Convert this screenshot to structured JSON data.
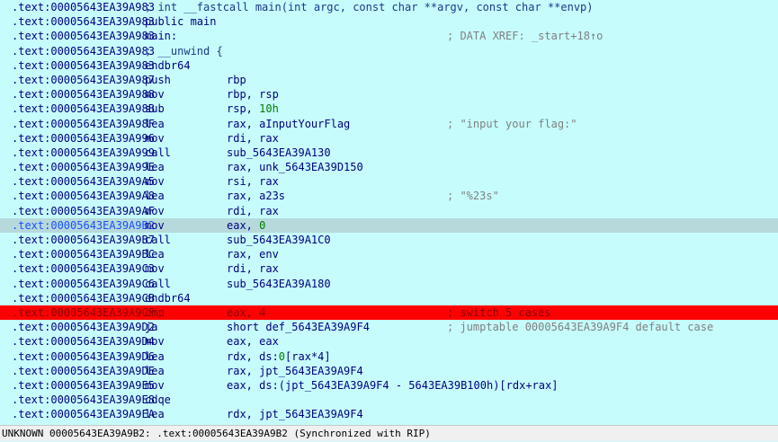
{
  "lines": [
    {
      "addr": ".text:00005643EA39A983",
      "full": "; int __fastcall main(int argc, const char **argv, const char **envp)"
    },
    {
      "addr": ".text:00005643EA39A983",
      "full": "public main"
    },
    {
      "addr": ".text:00005643EA39A983",
      "full": "main:",
      "cmt": "; DATA XREF: _start+18↑o"
    },
    {
      "addr": ".text:00005643EA39A983",
      "full": "; __unwind {"
    },
    {
      "addr": ".text:00005643EA39A983",
      "mnem": "endbr64"
    },
    {
      "addr": ".text:00005643EA39A987",
      "mnem": "push",
      "ops": "rbp"
    },
    {
      "addr": ".text:00005643EA39A988",
      "mnem": "mov",
      "ops": "rbp, rsp"
    },
    {
      "addr": ".text:00005643EA39A98B",
      "mnem": "sub",
      "ops": "rsp, ",
      "num": "10h"
    },
    {
      "addr": ".text:00005643EA39A98F",
      "mnem": "lea",
      "ops": "rax, aInputYourFlag",
      "cmt": "; \"input your flag:\""
    },
    {
      "addr": ".text:00005643EA39A996",
      "mnem": "mov",
      "ops": "rdi, rax"
    },
    {
      "addr": ".text:00005643EA39A999",
      "mnem": "call",
      "ops": "sub_5643EA39A130"
    },
    {
      "addr": ".text:00005643EA39A99E",
      "mnem": "lea",
      "ops": "rax, unk_5643EA39D150"
    },
    {
      "addr": ".text:00005643EA39A9A5",
      "mnem": "mov",
      "ops": "rsi, rax"
    },
    {
      "addr": ".text:00005643EA39A9A8",
      "mnem": "lea",
      "ops": "rax, a23s",
      "cmt": "; \"%23s\""
    },
    {
      "addr": ".text:00005643EA39A9AF",
      "mnem": "mov",
      "ops": "rdi, rax"
    },
    {
      "addr": ".text:00005643EA39A9B2",
      "mnem": "mov",
      "ops": "eax, ",
      "num": "0",
      "state": "sel"
    },
    {
      "addr": ".text:00005643EA39A9B7",
      "mnem": "call",
      "ops": "sub_5643EA39A1C0"
    },
    {
      "addr": ".text:00005643EA39A9BC",
      "mnem": "lea",
      "ops": "rax, env"
    },
    {
      "addr": ".text:00005643EA39A9C3",
      "mnem": "mov",
      "ops": "rdi, rax"
    },
    {
      "addr": ".text:00005643EA39A9C6",
      "mnem": "call",
      "ops": "sub_5643EA39A180"
    },
    {
      "addr": ".text:00005643EA39A9CB",
      "mnem": "endbr64"
    },
    {
      "addr": ".text:00005643EA39A9CF",
      "mnem": "cmp",
      "ops": "eax, ",
      "num": "4",
      "cmt": "; switch 5 cases",
      "state": "bp"
    },
    {
      "addr": ".text:00005643EA39A9D2",
      "mnem": "ja",
      "ops": "short def_5643EA39A9F4",
      "cmt": "; jumptable 00005643EA39A9F4 default case"
    },
    {
      "addr": ".text:00005643EA39A9D4",
      "mnem": "mov",
      "ops": "eax, eax"
    },
    {
      "addr": ".text:00005643EA39A9D6",
      "mnem": "lea",
      "ops": "rdx, ds:",
      "num": "0",
      "ops2": "[rax*4]"
    },
    {
      "addr": ".text:00005643EA39A9DE",
      "mnem": "lea",
      "ops": "rax, jpt_5643EA39A9F4"
    },
    {
      "addr": ".text:00005643EA39A9E5",
      "mnem": "mov",
      "ops": "eax, ds:(jpt_5643EA39A9F4 - 5643EA39B100h)[rdx+rax]"
    },
    {
      "addr": ".text:00005643EA39A9E8",
      "mnem": "cdqe"
    },
    {
      "addr": ".text:00005643EA39A9EA",
      "mnem": "lea",
      "ops": "rdx, jpt_5643EA39A9F4"
    }
  ],
  "status": {
    "segment": "UNKNOWN",
    "address": "00005643EA39A9B2:",
    "location": ".text:00005643EA39A9B2",
    "sync": "(Synchronized with RIP)"
  }
}
